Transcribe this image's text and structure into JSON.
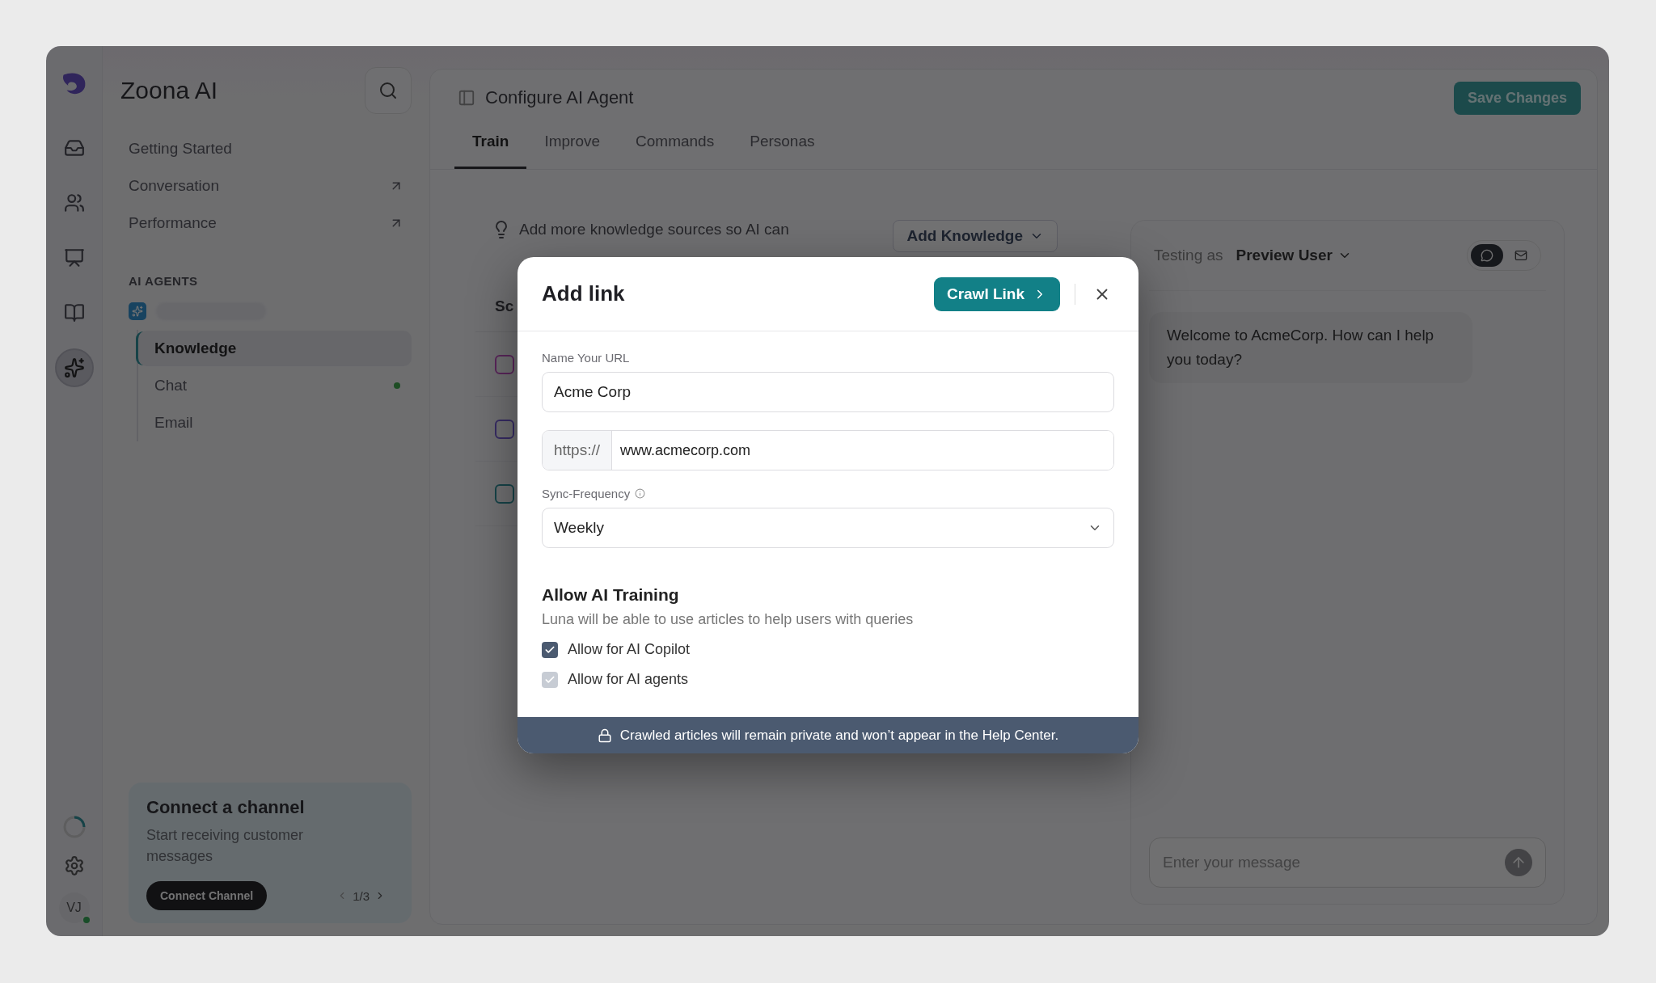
{
  "rail": {
    "items": [
      {
        "kind": "inbox",
        "selected": false
      },
      {
        "kind": "contacts",
        "selected": false
      },
      {
        "kind": "reports",
        "selected": false
      },
      {
        "kind": "knowledge",
        "selected": false
      },
      {
        "kind": "agent",
        "selected": true
      }
    ],
    "avatar": "VJ"
  },
  "sidebar": {
    "title": "Zoona AI",
    "nav": [
      {
        "label": "Getting Started",
        "external": false
      },
      {
        "label": "Conversation",
        "external": true
      },
      {
        "label": "Performance",
        "external": true
      }
    ],
    "section": "AI AGENTS",
    "agent_items": [
      {
        "label": "Knowledge",
        "selected": true,
        "live": false
      },
      {
        "label": "Chat",
        "selected": false,
        "live": true
      },
      {
        "label": "Email",
        "selected": false,
        "live": false
      }
    ],
    "card": {
      "title": "Connect a channel",
      "text": "Start receiving customer messages",
      "button": "Connect Channel",
      "pager": "1/3"
    }
  },
  "header": {
    "title": "Configure AI Agent",
    "save": "Save Changes"
  },
  "tabs": [
    {
      "label": "Train",
      "selected": true
    },
    {
      "label": "Improve",
      "selected": false
    },
    {
      "label": "Commands",
      "selected": false
    },
    {
      "label": "Personas",
      "selected": false
    }
  ],
  "knowledge": {
    "tip": "Add more knowledge sources so AI can",
    "add_button": "Add Knowledge",
    "table": {
      "column_1": "Sc"
    }
  },
  "test_panel": {
    "testing_label": "Testing as",
    "user": "Preview User",
    "modes": [
      {
        "kind": "chat",
        "selected": true
      },
      {
        "kind": "email",
        "selected": false
      }
    ],
    "message": "Welcome to AcmeCorp. How can I help you today?",
    "input": {
      "placeholder": "Enter your message"
    }
  },
  "modal": {
    "title": "Add link",
    "primary": "Crawl Link",
    "name_label": "Name Your URL",
    "name_value": "Acme Corp",
    "url_prefix": "https://",
    "url_value": "www.acmecorp.com",
    "sync_label": "Sync-Frequency",
    "sync_value": "Weekly",
    "training_title": "Allow AI Training",
    "training_text": "Luna will be able to use articles to help users with queries",
    "options": [
      {
        "label": "Allow for AI Copilot",
        "checked": true,
        "disabled": false
      },
      {
        "label": "Allow for AI agents",
        "checked": true,
        "disabled": true
      }
    ],
    "footer": "Crawled articles will remain private and won’t appear in the Help Center."
  }
}
